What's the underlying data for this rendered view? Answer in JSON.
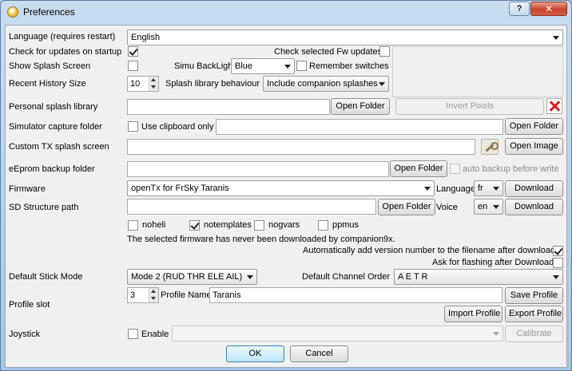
{
  "window": {
    "title": "Preferences",
    "help_label": "?",
    "close_label": "✕"
  },
  "language": {
    "label": "Language (requires restart)",
    "value": "English"
  },
  "updates": {
    "startup_label": "Check for updates on startup",
    "startup_checked": true,
    "fw_label": "Check selected Fw updates",
    "fw_checked": false
  },
  "splash": {
    "label": "Show Splash Screen",
    "checked": false,
    "backlight_label": "Simu BackLight",
    "backlight_value": "Blue",
    "remember_label": "Remember switches",
    "remember_checked": false
  },
  "history": {
    "label": "Recent History Size",
    "value": "10",
    "behaviour_label": "Splash library behaviour",
    "behaviour_value": "Include companion splashes"
  },
  "personal_splash": {
    "label": "Personal splash library",
    "value": "",
    "open_label": "Open Folder",
    "invert_label": "Invert Pixels"
  },
  "sim_capture": {
    "label": "Simulator capture folder",
    "clipboard_label": "Use clipboard only",
    "clipboard_checked": false,
    "value": "",
    "open_label": "Open Folder"
  },
  "custom_tx": {
    "label": "Custom TX splash screen",
    "value": "",
    "open_label": "Open Image"
  },
  "eeprom": {
    "label": "eEprom backup folder",
    "value": "",
    "open_label": "Open Folder",
    "auto_label": "auto backup before write",
    "auto_checked": false
  },
  "firmware": {
    "label": "Firmware",
    "value": "openTx for FrSky Taranis",
    "language_label": "Language",
    "language_value": "fr",
    "download_label": "Download"
  },
  "sd": {
    "label": "SD Structure path",
    "value": "",
    "open_label": "Open Folder",
    "voice_label": "Voice",
    "voice_value": "en",
    "download_label": "Download"
  },
  "options": [
    {
      "label": "noheli",
      "checked": false
    },
    {
      "label": "notemplates",
      "checked": true
    },
    {
      "label": "nogvars",
      "checked": false
    },
    {
      "label": "ppmus",
      "checked": false
    }
  ],
  "fw_status": "The selected firmware has never been downloaded by companion9x.",
  "auto_version": {
    "label": "Automatically add version number to the filename after download",
    "checked": true
  },
  "ask_flash": {
    "label": "Ask for flashing after Download",
    "checked": false
  },
  "stick_mode": {
    "label": "Default Stick Mode",
    "value": "Mode 2 (RUD THR ELE AIL)",
    "channel_label": "Default Channel Order",
    "channel_value": "A E T R"
  },
  "profile": {
    "label": "Profile slot",
    "slot": "3",
    "name_label": "Profile Name",
    "name_value": "Taranis",
    "save_label": "Save Profile",
    "import_label": "Import Profile",
    "export_label": "Export Profile"
  },
  "joystick": {
    "label": "Joystick",
    "enable_label": "Enable",
    "enable_checked": false,
    "value": "",
    "calibrate_label": "Calibrate"
  },
  "dialog": {
    "ok_label": "OK",
    "cancel_label": "Cancel"
  }
}
